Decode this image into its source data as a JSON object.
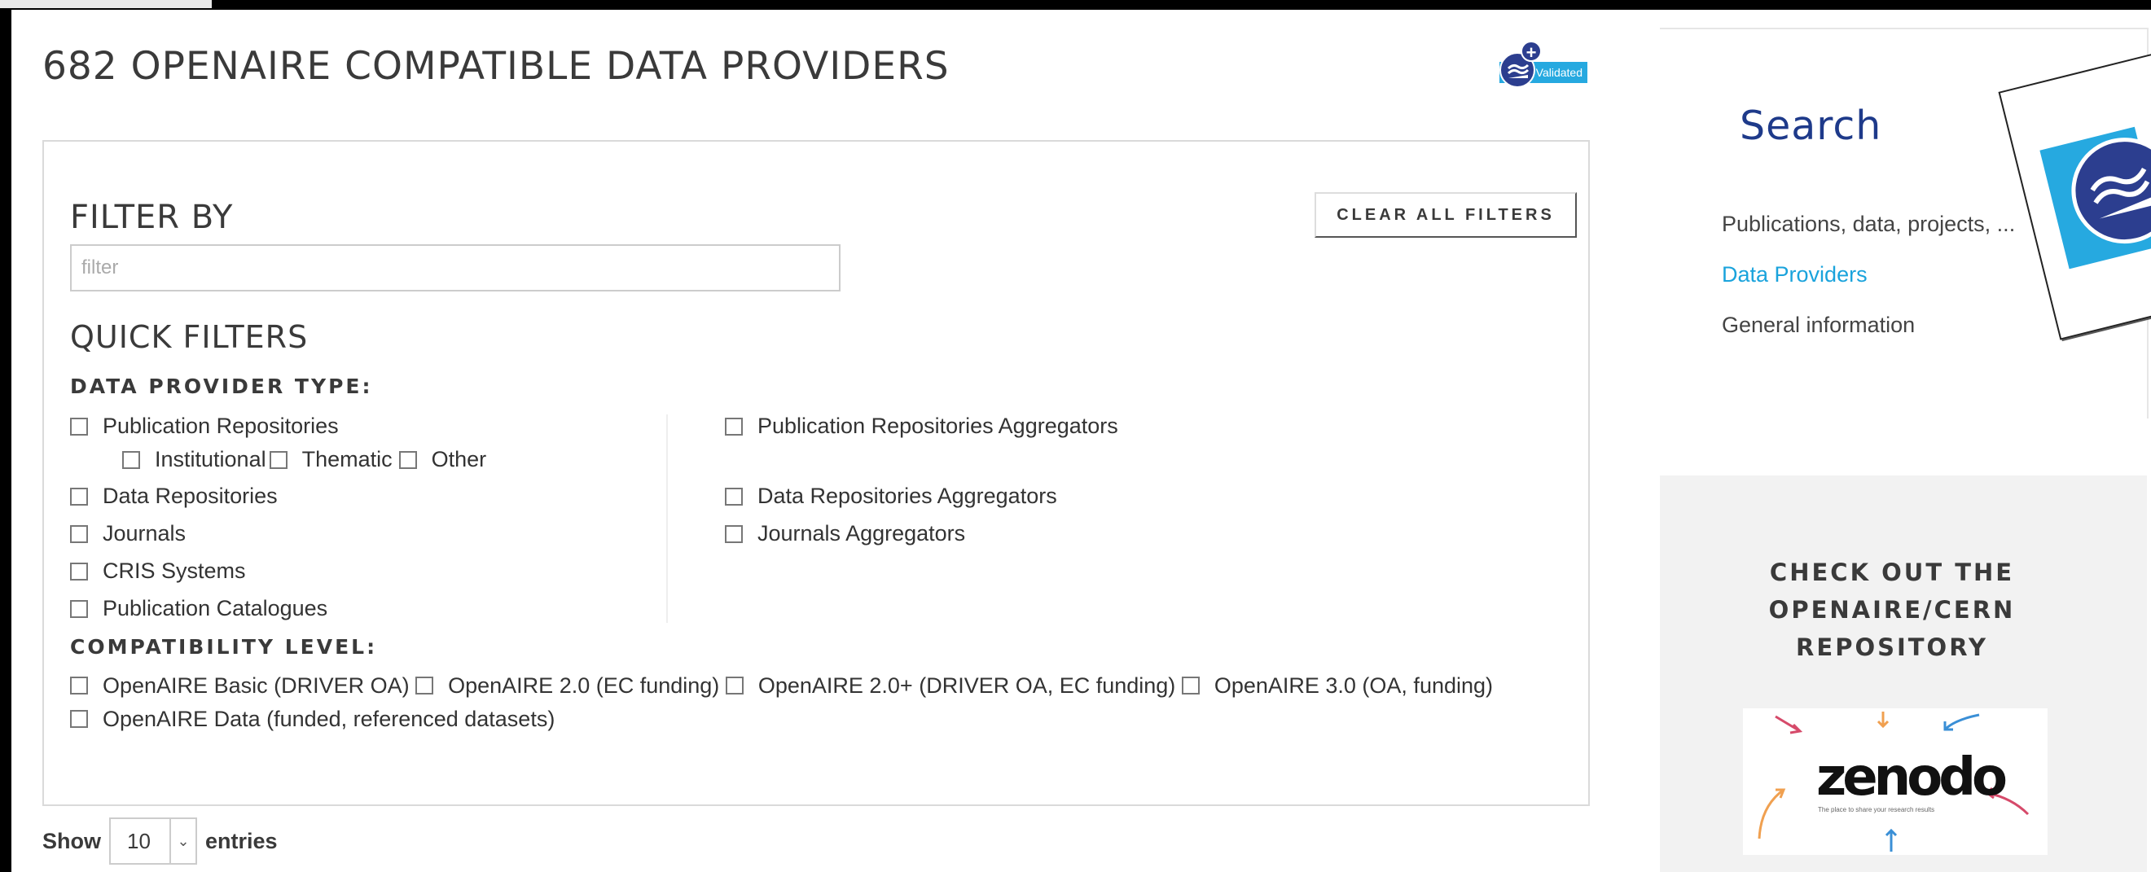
{
  "main": {
    "title": "682 OPENAIRE COMPATIBLE DATA PROVIDERS",
    "validated_badge": "Validated"
  },
  "filter": {
    "heading": "FILTER BY",
    "clear_label": "CLEAR ALL FILTERS",
    "input_placeholder": "filter",
    "quick_heading": "QUICK FILTERS",
    "type_heading": "DATA PROVIDER TYPE:",
    "types_left": {
      "pub_repos": "Publication Repositories",
      "institutional": "Institutional",
      "thematic": "Thematic",
      "other": "Other",
      "data_repos": "Data Repositories",
      "journals": "Journals",
      "cris": "CRIS Systems",
      "catalogues": "Publication Catalogues"
    },
    "types_right": {
      "pub_agg": "Publication Repositories Aggregators",
      "data_agg": "Data Repositories Aggregators",
      "journals_agg": "Journals Aggregators"
    },
    "compat_heading": "COMPATIBILITY LEVEL:",
    "compat": {
      "basic": "OpenAIRE Basic (DRIVER OA)",
      "v2": "OpenAIRE 2.0 (EC funding)",
      "v2plus": "OpenAIRE 2.0+ (DRIVER OA, EC funding)",
      "v3": "OpenAIRE 3.0 (OA, funding)",
      "data": "OpenAIRE Data (funded, referenced datasets)"
    }
  },
  "entries": {
    "show_label": "Show",
    "value": "10",
    "entries_label": "entries"
  },
  "sidebar": {
    "search_title": "Search",
    "links": {
      "publications": "Publications, data, projects, ...",
      "providers": "Data Providers",
      "general": "General information"
    },
    "promo_heading_1": "CHECK OUT THE",
    "promo_heading_2": "OPENAIRE/CERN",
    "promo_heading_3": "REPOSITORY",
    "zenodo_logo_text": "zenodo",
    "zenodo_tagline": "The place to share your research results"
  },
  "colors": {
    "accent_blue": "#1aa3dc",
    "brand_navy": "#2c3e8f",
    "search_title": "#1e3a8a"
  }
}
